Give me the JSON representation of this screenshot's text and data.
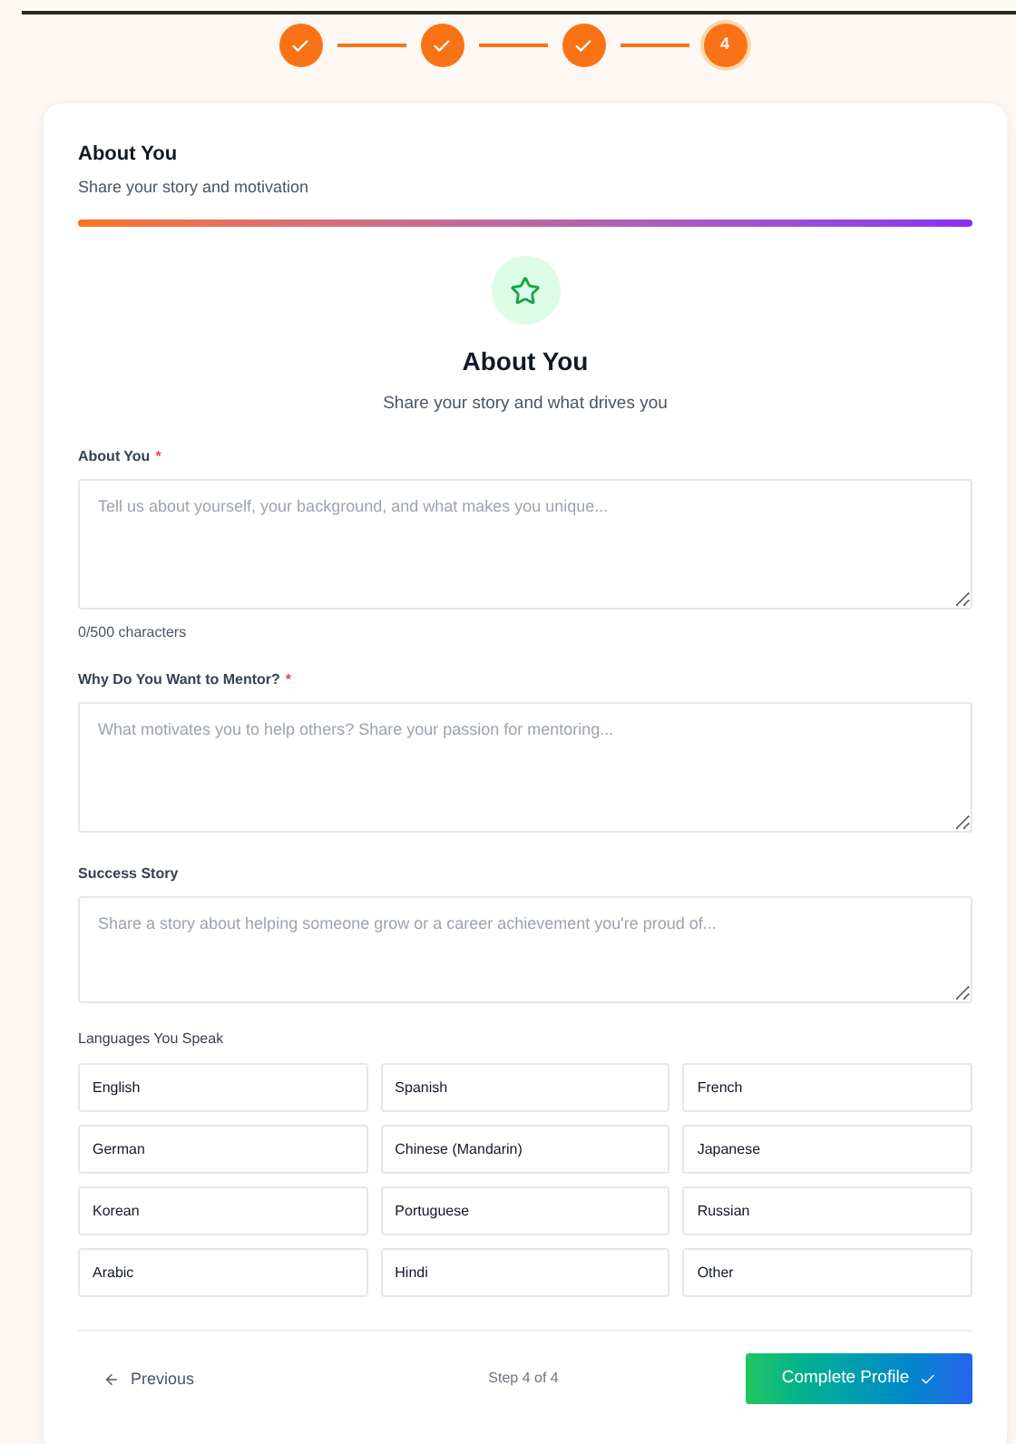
{
  "steps": [
    {
      "completed": true
    },
    {
      "completed": true
    },
    {
      "completed": true
    },
    {
      "completed": false,
      "label": "4"
    }
  ],
  "card": {
    "title": "About You",
    "subtitle": "Share your story and motivation"
  },
  "hero": {
    "title": "About You",
    "subtitle": "Share your story and what drives you"
  },
  "fields": [
    {
      "label": "About You",
      "required_mark": "*",
      "placeholder": "Tell us about yourself, your background, and what makes you unique...",
      "counter": "0/500 characters",
      "kind": "tall"
    },
    {
      "label": "Why Do You Want to Mentor?",
      "required_mark": "*",
      "placeholder": "What motivates you to help others? Share your passion for mentoring...",
      "kind": "tall"
    },
    {
      "label": "Success Story",
      "placeholder": "Share a story about helping someone grow or a career achievement you're proud of...",
      "kind": "short"
    }
  ],
  "languages": {
    "label": "Languages You Speak",
    "options": [
      {
        "label": "English",
        "selected": false
      },
      {
        "label": "Spanish",
        "selected": false
      },
      {
        "label": "French",
        "selected": false
      },
      {
        "label": "German",
        "selected": false
      },
      {
        "label": "Chinese (Mandarin)",
        "selected": false
      },
      {
        "label": "Japanese",
        "selected": false
      },
      {
        "label": "Korean",
        "selected": false
      },
      {
        "label": "Portuguese",
        "selected": false
      },
      {
        "label": "Russian",
        "selected": false
      },
      {
        "label": "Arabic",
        "selected": false
      },
      {
        "label": "Hindi",
        "selected": false
      },
      {
        "label": "Other",
        "selected": false
      }
    ]
  },
  "footer": {
    "previous": "Previous",
    "step_text": "Step 4 of 4",
    "submit": "Complete Profile"
  }
}
